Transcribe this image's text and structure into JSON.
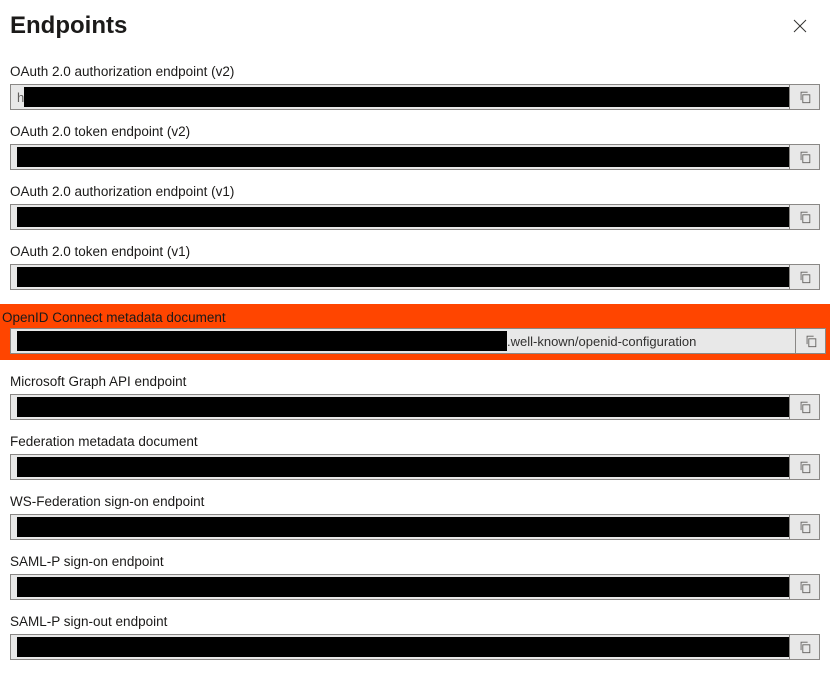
{
  "header": {
    "title": "Endpoints"
  },
  "endpoints": [
    {
      "label": "OAuth 2.0 authorization endpoint (v2)",
      "prefix": "h",
      "redactionWidth": "770px",
      "visible": "",
      "highlighted": false
    },
    {
      "label": "OAuth 2.0 token endpoint (v2)",
      "prefix": "",
      "redactionWidth": "778px",
      "visible": "",
      "highlighted": false
    },
    {
      "label": "OAuth 2.0 authorization endpoint (v1)",
      "prefix": "",
      "redactionWidth": "778px",
      "visible": "",
      "highlighted": false
    },
    {
      "label": "OAuth 2.0 token endpoint (v1)",
      "prefix": "",
      "redactionWidth": "778px",
      "visible": "",
      "highlighted": false
    },
    {
      "label": "OpenID Connect metadata document",
      "prefix": "",
      "redactionWidth": "490px",
      "visible": ".well-known/openid-configuration",
      "highlighted": true
    },
    {
      "label": "Microsoft Graph API endpoint",
      "prefix": "",
      "redactionWidth": "778px",
      "visible": "",
      "highlighted": false
    },
    {
      "label": "Federation metadata document",
      "prefix": "",
      "redactionWidth": "778px",
      "visible": "",
      "highlighted": false
    },
    {
      "label": "WS-Federation sign-on endpoint",
      "prefix": "",
      "redactionWidth": "778px",
      "visible": "",
      "highlighted": false
    },
    {
      "label": "SAML-P sign-on endpoint",
      "prefix": "",
      "redactionWidth": "778px",
      "visible": "",
      "highlighted": false
    },
    {
      "label": "SAML-P sign-out endpoint",
      "prefix": "",
      "redactionWidth": "778px",
      "visible": "",
      "highlighted": false
    }
  ]
}
